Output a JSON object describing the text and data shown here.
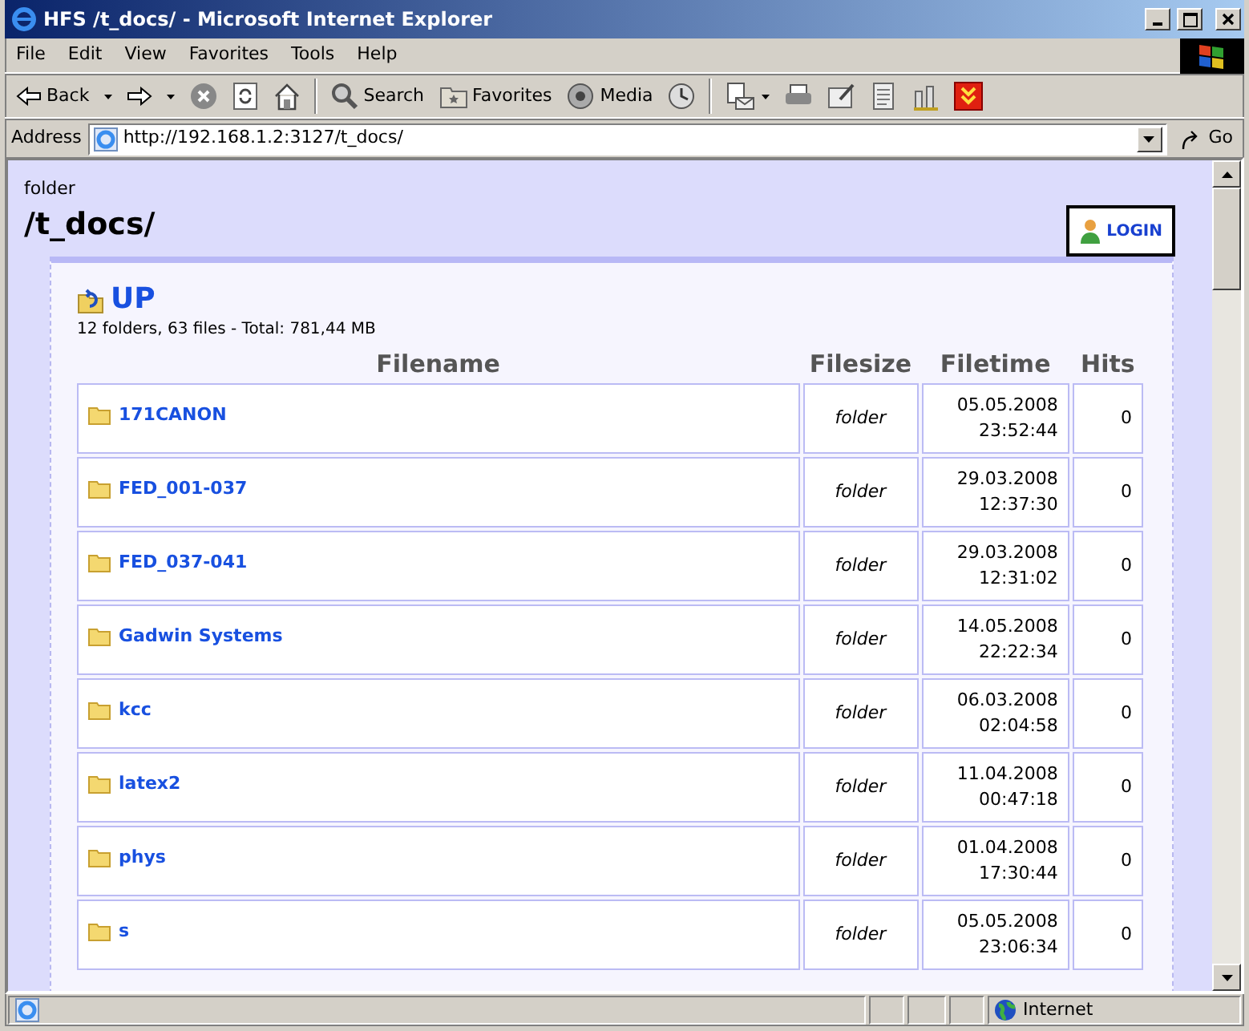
{
  "window": {
    "title": "HFS /t_docs/ - Microsoft Internet Explorer"
  },
  "menu": [
    "File",
    "Edit",
    "View",
    "Favorites",
    "Tools",
    "Help"
  ],
  "toolbar": {
    "back": "Back",
    "labeled": [
      "Search",
      "Favorites",
      "Media"
    ]
  },
  "address": {
    "label": "Address",
    "value": "http://192.168.1.2:3127/t_docs/",
    "go": "Go"
  },
  "page": {
    "folder_label": "folder",
    "path": "/t_docs/",
    "login": "LOGIN",
    "up": "UP",
    "summary": "12 folders, 63 files - Total: 781,44 MB",
    "columns": [
      "Filename",
      "Filesize",
      "Filetime",
      "Hits"
    ],
    "rows": [
      {
        "name": "171CANON",
        "size": "folder",
        "date": "05.05.2008",
        "time": "23:52:44",
        "hits": "0"
      },
      {
        "name": "FED_001-037",
        "size": "folder",
        "date": "29.03.2008",
        "time": "12:37:30",
        "hits": "0"
      },
      {
        "name": "FED_037-041",
        "size": "folder",
        "date": "29.03.2008",
        "time": "12:31:02",
        "hits": "0"
      },
      {
        "name": "Gadwin Systems",
        "size": "folder",
        "date": "14.05.2008",
        "time": "22:22:34",
        "hits": "0"
      },
      {
        "name": "kcc",
        "size": "folder",
        "date": "06.03.2008",
        "time": "02:04:58",
        "hits": "0"
      },
      {
        "name": "latex2",
        "size": "folder",
        "date": "11.04.2008",
        "time": "00:47:18",
        "hits": "0"
      },
      {
        "name": "phys",
        "size": "folder",
        "date": "01.04.2008",
        "time": "17:30:44",
        "hits": "0"
      },
      {
        "name": "s",
        "size": "folder",
        "date": "05.05.2008",
        "time": "23:06:34",
        "hits": "0"
      }
    ]
  },
  "status_bar": {
    "zone": "Internet"
  }
}
